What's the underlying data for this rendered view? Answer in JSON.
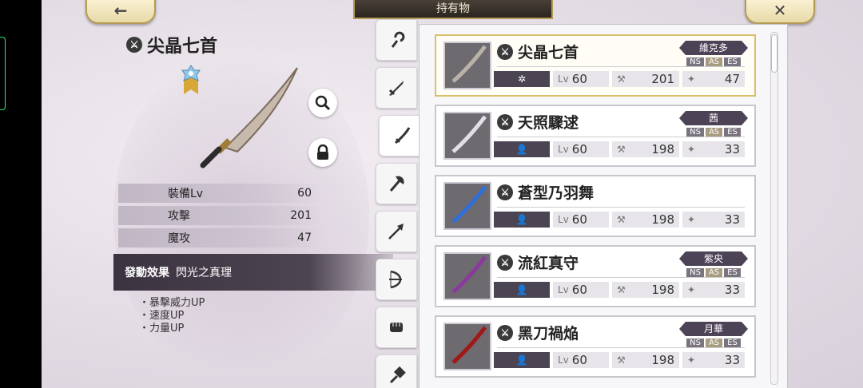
{
  "header": {
    "back_icon": "left-arrow-icon",
    "title": "持有物",
    "close_icon": "close-icon"
  },
  "selected": {
    "name": "尖晶七首",
    "stats": [
      {
        "label": "裝備Lv",
        "value": "60"
      },
      {
        "label": "攻擊",
        "value": "201"
      },
      {
        "label": "魔攻",
        "value": "47"
      }
    ],
    "effect_label": "發動效果",
    "effect_name": "閃光之真理",
    "effects": [
      "・暴擊威力UP",
      "・速度UP",
      "・力量UP"
    ]
  },
  "categories": [
    {
      "icon": "staff-icon"
    },
    {
      "icon": "sword-icon"
    },
    {
      "icon": "katana-icon",
      "active": true
    },
    {
      "icon": "axe-icon"
    },
    {
      "icon": "spear-icon"
    },
    {
      "icon": "bow-icon"
    },
    {
      "icon": "fist-icon"
    },
    {
      "icon": "hammer-icon"
    }
  ],
  "items": [
    {
      "name": "尖晶七首",
      "owner": "維克多",
      "slot": "✲",
      "lv_label": "Lv",
      "lv": "60",
      "atk": "201",
      "mag": "47",
      "types": [
        "NS",
        "AS",
        "ES"
      ],
      "blade_color": "#b9b2a8"
    },
    {
      "name": "天照驟逑",
      "owner": "茜",
      "slot": "👤",
      "lv_label": "Lv",
      "lv": "60",
      "atk": "198",
      "mag": "33",
      "types": [
        "NS",
        "AS",
        "ES"
      ],
      "blade_color": "#e0e0e6"
    },
    {
      "name": "蒼型乃羽舞",
      "owner": "",
      "slot": "👤",
      "lv_label": "Lv",
      "lv": "60",
      "atk": "198",
      "mag": "33",
      "types": [],
      "blade_color": "#2e6fd8"
    },
    {
      "name": "流紅真守",
      "owner": "紫央",
      "slot": "👤",
      "lv_label": "Lv",
      "lv": "60",
      "atk": "198",
      "mag": "33",
      "types": [
        "NS",
        "AS",
        "ES"
      ],
      "blade_color": "#8a3a9a"
    },
    {
      "name": "黑刀禍焔",
      "owner": "月華",
      "slot": "👤",
      "lv_label": "Lv",
      "lv": "60",
      "atk": "198",
      "mag": "33",
      "types": [
        "NS",
        "AS",
        "ES"
      ],
      "blade_color": "#a01818"
    }
  ],
  "colors": {
    "accent_gold": "#d8bf6a",
    "panel_dark": "#4b4452"
  }
}
